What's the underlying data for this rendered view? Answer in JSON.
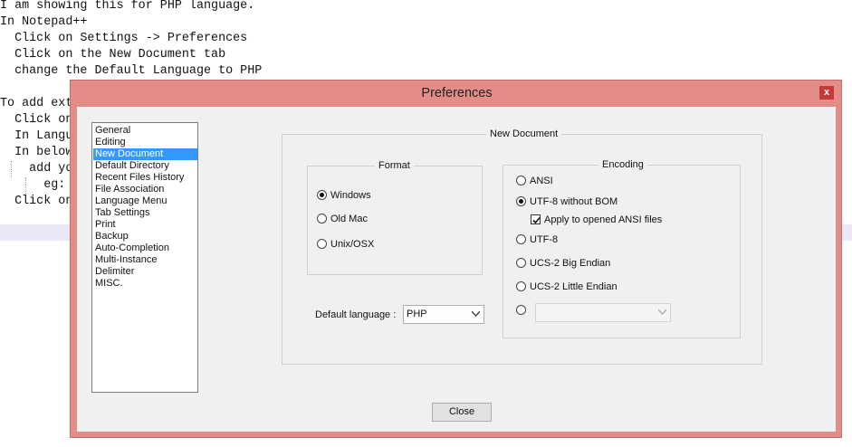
{
  "editor": {
    "lines": [
      "I am showing this for PHP language.",
      "In Notepad++",
      "  Click on Settings -> Preferences",
      "  Click on the New Document tab",
      "  change the Default Language to PHP",
      "",
      "To add exte",
      "  Click on",
      "  In Langua",
      "  In below",
      "    add you",
      "      eg: ",
      "  Click on"
    ]
  },
  "dialog": {
    "title": "Preferences",
    "close_glyph": "x",
    "categories": [
      "General",
      "Editing",
      "New Document",
      "Default Directory",
      "Recent Files History",
      "File Association",
      "Language Menu",
      "Tab Settings",
      "Print",
      "Backup",
      "Auto-Completion",
      "Multi-Instance",
      "Delimiter",
      "MISC."
    ],
    "selected_category": "New Document",
    "panel_title": "New Document",
    "format": {
      "label": "Format",
      "options": [
        "Windows",
        "Old Mac",
        "Unix/OSX"
      ],
      "selected": "Windows"
    },
    "encoding": {
      "label": "Encoding",
      "options": [
        "ANSI",
        "UTF-8 without BOM",
        "UTF-8",
        "UCS-2 Big Endian",
        "UCS-2 Little Endian"
      ],
      "selected": "UTF-8 without BOM",
      "apply_checkbox_label": "Apply to opened ANSI files",
      "apply_checked": true,
      "extra_combo_value": ""
    },
    "default_language": {
      "label": "Default language :",
      "value": "PHP"
    },
    "close_button": "Close"
  }
}
